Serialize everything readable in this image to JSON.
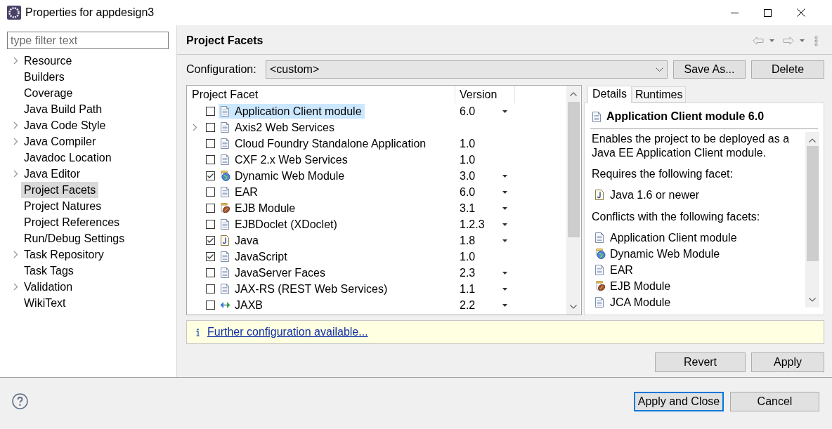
{
  "window": {
    "title": "Properties for appdesign3"
  },
  "sidebar": {
    "filter": {
      "placeholder": "type filter text"
    },
    "items": [
      {
        "label": "Resource",
        "expandable": true,
        "selected": false
      },
      {
        "label": "Builders",
        "expandable": false,
        "selected": false
      },
      {
        "label": "Coverage",
        "expandable": false,
        "selected": false
      },
      {
        "label": "Java Build Path",
        "expandable": false,
        "selected": false
      },
      {
        "label": "Java Code Style",
        "expandable": true,
        "selected": false
      },
      {
        "label": "Java Compiler",
        "expandable": true,
        "selected": false
      },
      {
        "label": "Javadoc Location",
        "expandable": false,
        "selected": false
      },
      {
        "label": "Java Editor",
        "expandable": true,
        "selected": false
      },
      {
        "label": "Project Facets",
        "expandable": false,
        "selected": true
      },
      {
        "label": "Project Natures",
        "expandable": false,
        "selected": false
      },
      {
        "label": "Project References",
        "expandable": false,
        "selected": false
      },
      {
        "label": "Run/Debug Settings",
        "expandable": false,
        "selected": false
      },
      {
        "label": "Task Repository",
        "expandable": true,
        "selected": false
      },
      {
        "label": "Task Tags",
        "expandable": false,
        "selected": false
      },
      {
        "label": "Validation",
        "expandable": true,
        "selected": false
      },
      {
        "label": "WikiText",
        "expandable": false,
        "selected": false
      }
    ]
  },
  "page": {
    "title": "Project Facets"
  },
  "configuration": {
    "label": "Configuration:",
    "value": "<custom>",
    "buttons": [
      "Save As...",
      "Delete"
    ]
  },
  "facets_table": {
    "columns": [
      "Project Facet",
      "Version"
    ],
    "rows": [
      {
        "name": "Application Client module",
        "version": "6.0",
        "kind": "file",
        "checked": false,
        "selected": true,
        "expandable": false,
        "version_menu": true
      },
      {
        "name": "Axis2 Web Services",
        "kind": "file",
        "checked": false,
        "selected": false,
        "expandable": true,
        "version_menu": false
      },
      {
        "name": "Cloud Foundry Standalone Application",
        "version": "1.0",
        "kind": "file",
        "checked": false,
        "selected": false,
        "expandable": false,
        "version_menu": false
      },
      {
        "name": "CXF 2.x Web Services",
        "version": "1.0",
        "kind": "file",
        "checked": false,
        "selected": false,
        "expandable": false,
        "version_menu": false
      },
      {
        "name": "Dynamic Web Module",
        "version": "3.0",
        "kind": "web",
        "checked": true,
        "selected": false,
        "expandable": false,
        "version_menu": true
      },
      {
        "name": "EAR",
        "version": "6.0",
        "kind": "file",
        "checked": false,
        "selected": false,
        "expandable": false,
        "version_menu": true
      },
      {
        "name": "EJB Module",
        "version": "3.1",
        "kind": "ejb",
        "checked": false,
        "selected": false,
        "expandable": false,
        "version_menu": true
      },
      {
        "name": "EJBDoclet (XDoclet)",
        "version": "1.2.3",
        "kind": "file",
        "checked": false,
        "selected": false,
        "expandable": false,
        "version_menu": true
      },
      {
        "name": "Java",
        "version": "1.8",
        "kind": "java",
        "checked": true,
        "selected": false,
        "expandable": false,
        "version_menu": true
      },
      {
        "name": "JavaScript",
        "version": "1.0",
        "kind": "file",
        "checked": true,
        "selected": false,
        "expandable": false,
        "version_menu": false
      },
      {
        "name": "JavaServer Faces",
        "version": "2.3",
        "kind": "file",
        "checked": false,
        "selected": false,
        "expandable": false,
        "version_menu": true
      },
      {
        "name": "JAX-RS (REST Web Services)",
        "version": "1.1",
        "kind": "file",
        "checked": false,
        "selected": false,
        "expandable": false,
        "version_menu": true
      },
      {
        "name": "JAXB",
        "version": "2.2",
        "kind": "binding",
        "checked": false,
        "selected": false,
        "expandable": false,
        "version_menu": true
      }
    ]
  },
  "details": {
    "tabs": [
      {
        "label": "Details",
        "selected": true
      },
      {
        "label": "Runtimes",
        "selected": false
      }
    ],
    "heading": {
      "label": "Application Client module 6.0",
      "kind": "file"
    },
    "description": "Enables the project to be deployed as a Java EE Application Client module.",
    "sections": [
      {
        "heading": "Requires the following facet:",
        "items": [
          {
            "label": "Java 1.6 or newer",
            "kind": "java"
          }
        ]
      },
      {
        "heading": "Conflicts with the following facets:",
        "items": [
          {
            "label": "Application Client module",
            "kind": "file"
          },
          {
            "label": "Dynamic Web Module",
            "kind": "web"
          },
          {
            "label": "EAR",
            "kind": "file"
          },
          {
            "label": "EJB Module",
            "kind": "ejb"
          },
          {
            "label": "JCA Module",
            "kind": "file"
          }
        ]
      }
    ]
  },
  "info_bar": {
    "link": "Further configuration available..."
  },
  "page_buttons": [
    "Revert",
    "Apply"
  ],
  "footer_buttons": [
    {
      "label": "Apply and Close",
      "default": true
    },
    {
      "label": "Cancel",
      "default": false
    }
  ]
}
